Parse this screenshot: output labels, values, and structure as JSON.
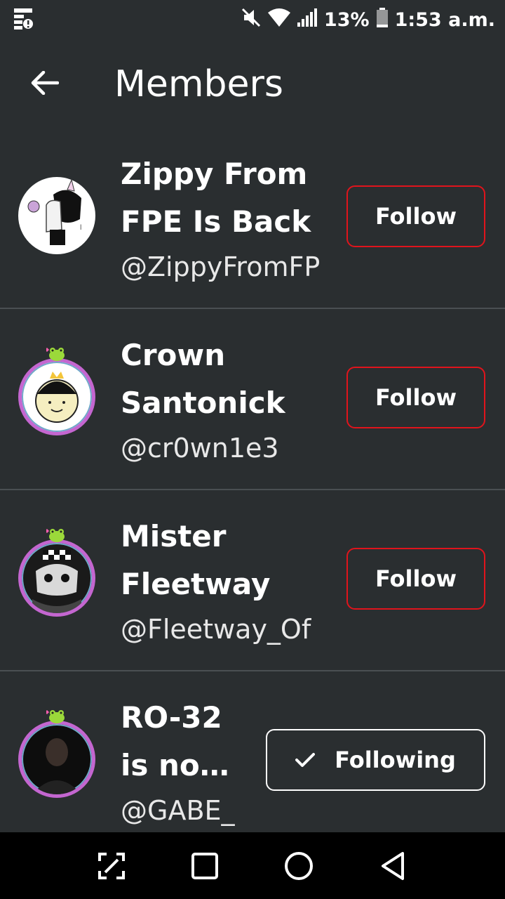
{
  "status_bar": {
    "battery": "13%",
    "time": "1:53 a.m.",
    "icons": [
      "notification-icon",
      "mute-icon",
      "wifi-icon",
      "signal-icon",
      "battery-icon"
    ]
  },
  "header": {
    "title": "Members",
    "back_icon": "arrow-left-icon"
  },
  "members": [
    {
      "display_name": "Zippy From\nFPE Is Back",
      "username": "@ZippyFromFP",
      "button": "Follow",
      "following": false
    },
    {
      "display_name": "Crown\nSantonick",
      "username": "@cr0wn1e3",
      "button": "Follow",
      "following": false
    },
    {
      "display_name": "Mister\nFleetway",
      "username": "@Fleetway_Of",
      "button": "Follow",
      "following": false
    },
    {
      "display_name": "RO-32\nis no…",
      "username": "@GABE_",
      "button": "Following",
      "following": true
    }
  ],
  "colors": {
    "background": "#2a2e30",
    "follow_border": "#e0141c",
    "following_border": "#ffffff",
    "avatar_frame": "#c466d0"
  },
  "nav_bar": {
    "icons": [
      "screenshot-edit-icon",
      "recents-square-icon",
      "home-circle-icon",
      "back-triangle-icon"
    ]
  }
}
